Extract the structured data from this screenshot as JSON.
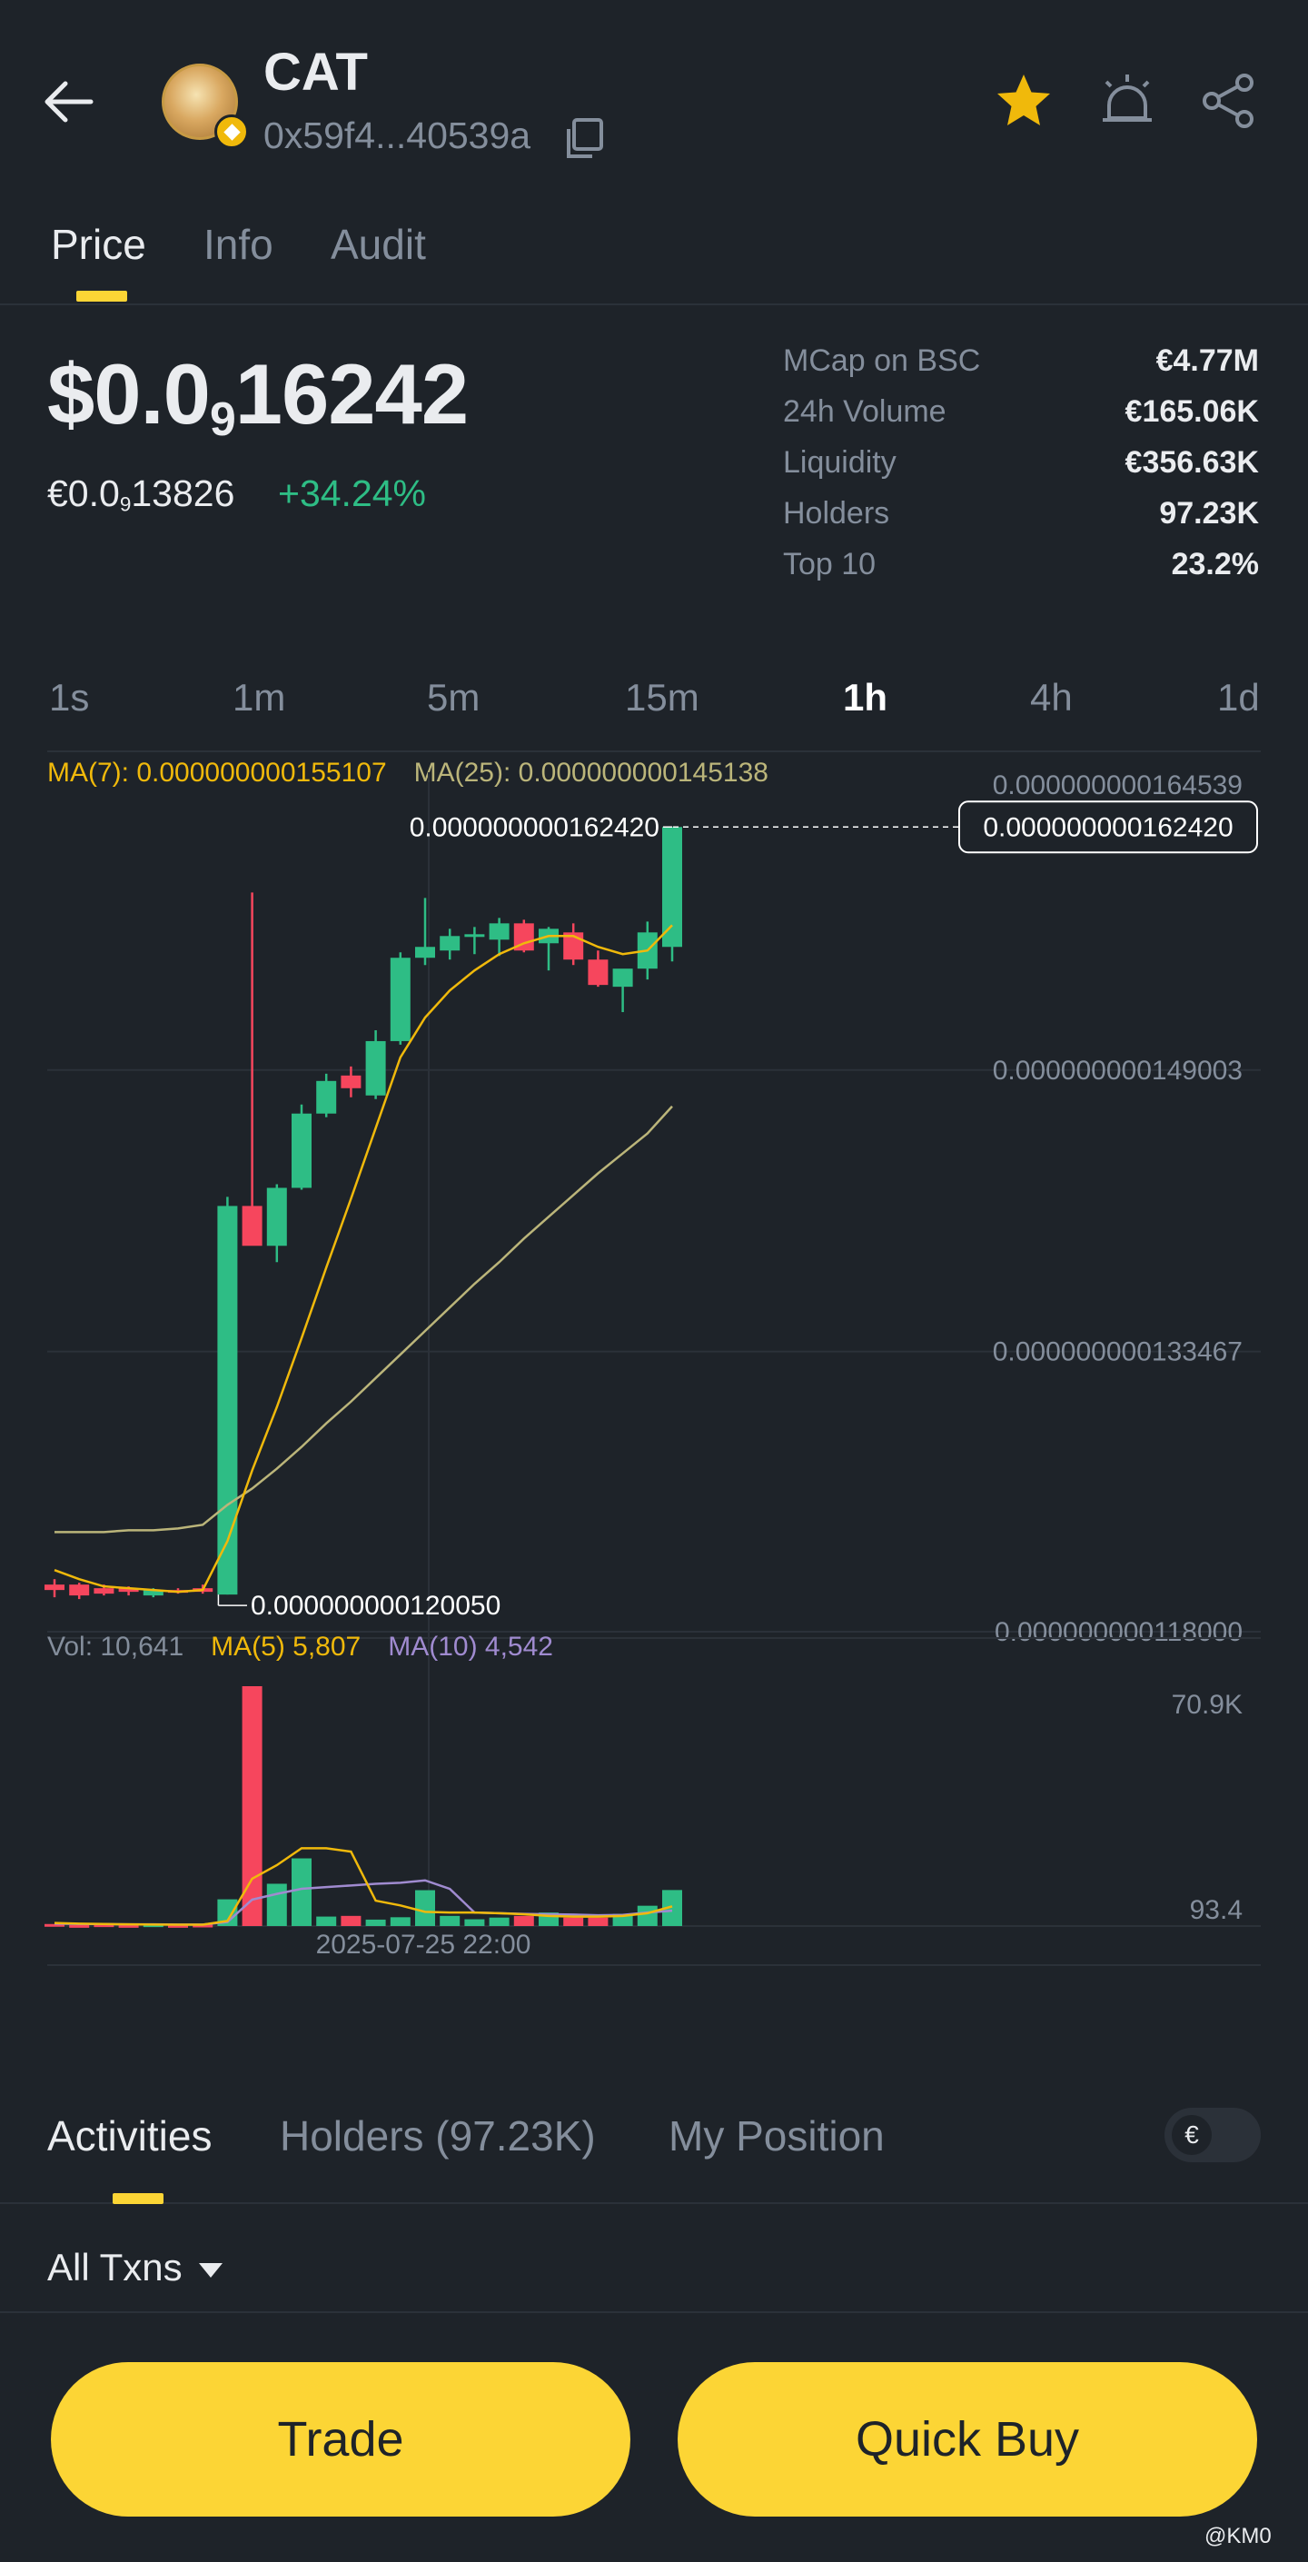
{
  "header": {
    "token_name": "CAT",
    "token_address": "0x59f4...40539a",
    "icons": [
      "back-arrow-icon",
      "token-logo",
      "bnb-chain-icon",
      "copy-icon",
      "star-icon",
      "price-alert-icon",
      "share-icon"
    ],
    "favorite_color": "#f0b90b"
  },
  "tabs": [
    "Price",
    "Info",
    "Audit"
  ],
  "active_tab": "Price",
  "price": {
    "usd_prefix": "$0.0",
    "usd_zeros": "9",
    "usd_digits": "16242",
    "eur_prefix": "€0.0",
    "eur_zeros": "9",
    "eur_digits": "13826",
    "change": "+34.24%"
  },
  "stats": [
    {
      "label": "MCap on BSC",
      "value": "€4.77M"
    },
    {
      "label": "24h Volume",
      "value": "€165.06K"
    },
    {
      "label": "Liquidity",
      "value": "€356.63K"
    },
    {
      "label": "Holders",
      "value": "97.23K"
    },
    {
      "label": "Top 10",
      "value": "23.2%"
    }
  ],
  "timeframes": [
    "1s",
    "1m",
    "5m",
    "15m",
    "1h",
    "4h",
    "1d"
  ],
  "active_timeframe": "1h",
  "ma_legend": {
    "ma7": "MA(7): 0.000000000155107",
    "ma25": "MA(25): 0.000000000145138"
  },
  "volume_legend": {
    "vol": "Vol: 10,641",
    "ma5": "MA(5) 5,807",
    "ma10": "MA(10) 4,542"
  },
  "colors": {
    "up": "#2ebd85",
    "down": "#f6465d",
    "accent": "#fcd535",
    "ma7": "#f0b90b",
    "ma25": "#bbb57a",
    "ma10": "#a08bd0"
  },
  "chart_data": {
    "type": "candlestick",
    "price_axis_labels": [
      "0.000000000164539",
      "0.000000000149003",
      "0.000000000133467",
      "0.000000000118000"
    ],
    "ylim": [
      1.18e-10,
      1.64539e-10
    ],
    "last_price_label": "0.000000000162420",
    "high_marker_label": "0.000000000162420",
    "low_marker_label": "0.000000000120050",
    "x_crosshair_label": "2025-07-25 22:00",
    "volume_axis_labels": [
      "70.9K",
      "93.4"
    ],
    "candles_e12": [
      {
        "o": 120.6,
        "h": 120.9,
        "l": 119.9,
        "c": 120.3
      },
      {
        "o": 120.6,
        "h": 120.7,
        "l": 119.8,
        "c": 120.0
      },
      {
        "o": 120.4,
        "h": 120.6,
        "l": 120.0,
        "c": 120.1
      },
      {
        "o": 120.4,
        "h": 120.5,
        "l": 120.0,
        "c": 120.2
      },
      {
        "o": 120.0,
        "h": 120.4,
        "l": 119.9,
        "c": 120.3
      },
      {
        "o": 120.3,
        "h": 120.4,
        "l": 120.1,
        "c": 120.2
      },
      {
        "o": 120.4,
        "h": 120.6,
        "l": 120.1,
        "c": 120.2
      },
      {
        "o": 120.05,
        "h": 142.0,
        "l": 120.05,
        "c": 141.5
      },
      {
        "o": 141.5,
        "h": 158.8,
        "l": 139.4,
        "c": 139.3
      },
      {
        "o": 139.3,
        "h": 142.7,
        "l": 138.4,
        "c": 142.5
      },
      {
        "o": 142.5,
        "h": 147.1,
        "l": 142.4,
        "c": 146.6
      },
      {
        "o": 146.6,
        "h": 148.8,
        "l": 146.4,
        "c": 148.4
      },
      {
        "o": 148.7,
        "h": 149.2,
        "l": 147.5,
        "c": 148.0
      },
      {
        "o": 147.6,
        "h": 151.2,
        "l": 147.4,
        "c": 150.6
      },
      {
        "o": 150.6,
        "h": 155.5,
        "l": 150.4,
        "c": 155.2
      },
      {
        "o": 155.2,
        "h": 158.5,
        "l": 154.8,
        "c": 155.8
      },
      {
        "o": 155.6,
        "h": 156.8,
        "l": 155.1,
        "c": 156.4
      },
      {
        "o": 156.5,
        "h": 156.9,
        "l": 155.4,
        "c": 156.5
      },
      {
        "o": 156.2,
        "h": 157.4,
        "l": 155.3,
        "c": 157.1
      },
      {
        "o": 157.1,
        "h": 157.3,
        "l": 155.5,
        "c": 155.6
      },
      {
        "o": 156.0,
        "h": 156.9,
        "l": 154.5,
        "c": 156.8
      },
      {
        "o": 156.6,
        "h": 157.1,
        "l": 154.8,
        "c": 155.1
      },
      {
        "o": 155.1,
        "h": 155.6,
        "l": 153.6,
        "c": 153.7
      },
      {
        "o": 153.6,
        "h": 154.2,
        "l": 152.2,
        "c": 154.6
      },
      {
        "o": 154.6,
        "h": 157.2,
        "l": 154.0,
        "c": 156.6
      },
      {
        "o": 155.8,
        "h": 162.42,
        "l": 155.0,
        "c": 162.42
      }
    ],
    "ma7_e12": [
      121.4,
      120.9,
      120.5,
      120.4,
      120.3,
      120.2,
      120.3,
      123.0,
      126.9,
      130.4,
      134.2,
      138.1,
      141.9,
      145.8,
      149.7,
      151.9,
      153.4,
      154.5,
      155.4,
      156.0,
      156.4,
      156.4,
      155.8,
      155.4,
      155.6,
      157.0
    ],
    "ma25_e12": [
      123.5,
      123.5,
      123.5,
      123.6,
      123.6,
      123.7,
      123.9,
      125.0,
      125.9,
      127.0,
      128.2,
      129.5,
      130.7,
      132.0,
      133.3,
      134.6,
      135.9,
      137.2,
      138.4,
      139.7,
      140.9,
      142.1,
      143.3,
      144.4,
      145.5,
      147.0
    ],
    "volume": [
      600,
      300,
      500,
      300,
      500,
      300,
      400,
      7900,
      70900,
      12500,
      20000,
      2800,
      3000,
      1900,
      2600,
      10600,
      3000,
      2000,
      2500,
      3000,
      4000,
      2500,
      2500,
      3600,
      6000,
      10641
    ],
    "vol_ma5": [
      900,
      700,
      600,
      500,
      450,
      400,
      400,
      1500,
      14000,
      18000,
      23000,
      23000,
      22000,
      7500,
      6100,
      4200,
      4000,
      4000,
      3800,
      3500,
      3000,
      2800,
      2800,
      3000,
      3800,
      5807
    ],
    "vol_ma10": [
      700,
      600,
      600,
      500,
      500,
      450,
      450,
      1200,
      7800,
      9500,
      11000,
      11500,
      12000,
      12500,
      12800,
      13500,
      11000,
      4000,
      3800,
      3600,
      3500,
      3400,
      3200,
      3300,
      4000,
      4542
    ]
  },
  "activity_tabs": [
    "Activities",
    "Holders (97.23K)",
    "My Position"
  ],
  "active_activity_tab": "Activities",
  "currency_toggle": "€",
  "filter_label": "All Txns",
  "buttons": {
    "trade": "Trade",
    "quick_buy": "Quick Buy"
  },
  "watermark": "@KM0"
}
